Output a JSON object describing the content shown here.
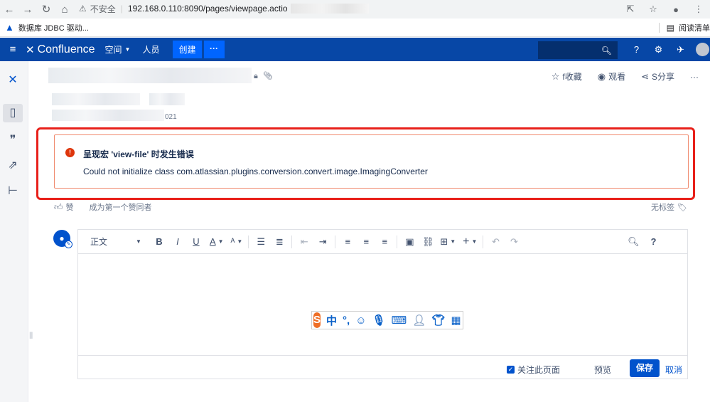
{
  "browser": {
    "security_label": "不安全",
    "url": "192.168.0.110:8090/pages/viewpage.actio",
    "bookmark_label": "数据库 JDBC 驱动...",
    "reading_list_label": "阅读清单"
  },
  "header": {
    "app_name": "Confluence",
    "spaces_label": "空间",
    "people_label": "人员",
    "create_label": "创建",
    "more_label": "···"
  },
  "page": {
    "date_suffix": "021",
    "actions": {
      "star_label": "f收藏",
      "watch_label": "观看",
      "share_label": "S分享",
      "more_label": "···"
    }
  },
  "error": {
    "title": "呈现宏 'view-file' 时发生错误",
    "message": "Could not initialize class com.atlassian.plugins.conversion.convert.image.ImagingConverter"
  },
  "likes": {
    "like_label": "赞",
    "first_label": "成为第一个赞同者"
  },
  "labels": {
    "none_label": "无标签"
  },
  "editor": {
    "style_label": "正文",
    "watch_label": "关注此页面",
    "preview_label": "预览",
    "save_label": "保存",
    "cancel_label": "取消"
  },
  "ime": {
    "logo": "S",
    "mode": "中",
    "punct": "°,"
  },
  "colors": {
    "header_bg": "#0747a6",
    "primary": "#0052cc",
    "error": "#de350b",
    "highlight": "#e8201a"
  }
}
